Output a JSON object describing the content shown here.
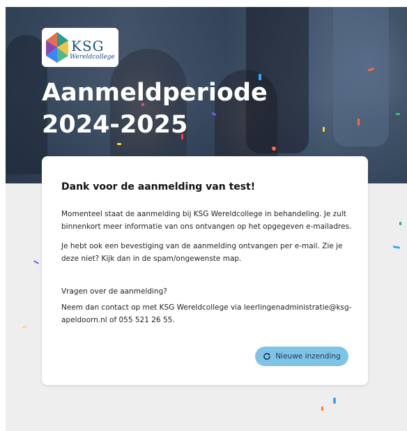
{
  "hero": {
    "title": "Aanmeldperiode 2024-2025",
    "logo": {
      "text": "KSG",
      "subtext": "Wereldcollege"
    }
  },
  "card": {
    "heading": "Dank voor de aanmelding van test!",
    "paragraphs": [
      "Momenteel staat de aanmelding bij KSG Wereldcollege in behandeling. Je zult binnenkort meer informatie van ons ontvangen op het opgegeven e-mailadres.",
      "Je hebt ook een bevestiging van de aanmelding ontvangen per e-mail. Zie je deze niet? Kijk dan in de spam/ongewenste map."
    ],
    "question": "Vragen over de aanmelding?",
    "contact": "Neem dan contact op met KSG Wereldcollege via leerlingenadministratie@ksg-apeldoorn.nl of 055 521 26 55.",
    "button_label": "Nieuwe inzending",
    "button_icon": "refresh-icon"
  },
  "colors": {
    "accent": "#7fc4e6",
    "page_bg": "#eeeeee",
    "logo_blue": "#1d4e8a"
  }
}
